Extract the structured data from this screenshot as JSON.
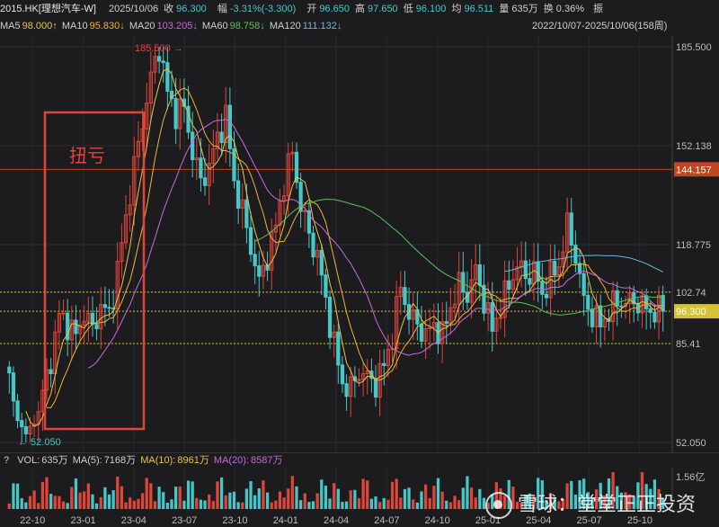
{
  "header": {
    "symbol": "2015.HK[理想汽车-W]",
    "date": "2025/10/06",
    "close_label": "收",
    "close": "96.300",
    "change_label": "幅",
    "change": "-3.31%(-3.300)",
    "open_label": "开",
    "open": "96.650",
    "high_label": "高",
    "high": "97.650",
    "low_label": "低",
    "low": "96.100",
    "avg_label": "均",
    "avg": "96.511",
    "vol_label": "量",
    "vol": "635万",
    "turnover_label": "换",
    "turnover": "0.36%",
    "amp_label": "振"
  },
  "ma_row": {
    "range_text": "2022/10/07-2025/10/06(158周)",
    "items": [
      {
        "label": "MA5",
        "value": "98.000↑",
        "color": "#e8c547"
      },
      {
        "label": "MA10",
        "value": "95.830↓",
        "color": "#f2b233"
      },
      {
        "label": "MA20",
        "value": "103.205↓",
        "color": "#c86adc"
      },
      {
        "label": "MA60",
        "value": "98.758↓",
        "color": "#5fbf5f"
      },
      {
        "label": "MA120",
        "value": "111.132↓",
        "color": "#6fb6d8"
      }
    ]
  },
  "annotation": {
    "text": "扭亏",
    "color": "#e0453a"
  },
  "volume_row": {
    "prefix": "?",
    "items": [
      {
        "label": "VOL:",
        "value": "635万",
        "color": "#cfcfcf"
      },
      {
        "label": "MA(5):",
        "value": "7168万",
        "color": "#cfcfcf"
      },
      {
        "label": "MA(10):",
        "value": "8961万",
        "color": "#e8c547"
      },
      {
        "label": "MA(20):",
        "value": "8587万",
        "color": "#c86adc"
      }
    ]
  },
  "watermark": "雪球：堂堂正正投资",
  "chart_data": {
    "type": "candlestick",
    "period": "weekly",
    "x_ticks": [
      "22-10",
      "23-01",
      "23-04",
      "23-07",
      "23-10",
      "24-01",
      "24-04",
      "24-07",
      "24-10",
      "25-01",
      "25-04",
      "25-07",
      "25-10"
    ],
    "y_ticks": [
      "185.500",
      "152.138",
      "118.775",
      "102.74",
      "85.41",
      "52.050"
    ],
    "y_tick_values": [
      185.5,
      152.138,
      118.775,
      102.74,
      85.41,
      52.05
    ],
    "ylim": [
      52.05,
      185.5
    ],
    "max_label": "185.500",
    "min_label": "52.050",
    "ref_lines": [
      {
        "value": 144.157,
        "label": "144.157",
        "color": "#c0461f"
      },
      {
        "value": 102.74,
        "color": "#d6c236"
      },
      {
        "value": 96.3,
        "label": "96.300",
        "color": "#d6c236"
      },
      {
        "value": 85.41,
        "color": "#d6c236"
      }
    ],
    "volume_ticks": [
      "1.56亿"
    ],
    "volume_max": 156000000,
    "colors": {
      "up": "#e0453a",
      "down": "#45c8c8"
    },
    "anchors": [
      [
        0,
        73
      ],
      [
        2,
        58
      ],
      [
        3,
        62
      ],
      [
        4,
        52.05
      ],
      [
        6,
        60
      ],
      [
        8,
        68
      ],
      [
        10,
        80
      ],
      [
        12,
        95
      ],
      [
        14,
        92
      ],
      [
        16,
        88
      ],
      [
        18,
        96
      ],
      [
        20,
        90
      ],
      [
        22,
        98
      ],
      [
        24,
        95
      ],
      [
        26,
        110
      ],
      [
        28,
        128
      ],
      [
        30,
        145
      ],
      [
        32,
        160
      ],
      [
        34,
        175
      ],
      [
        36,
        185.5
      ],
      [
        38,
        170
      ],
      [
        40,
        163
      ],
      [
        42,
        165
      ],
      [
        44,
        150
      ],
      [
        46,
        140
      ],
      [
        48,
        145
      ],
      [
        50,
        155
      ],
      [
        52,
        162
      ],
      [
        54,
        140
      ],
      [
        56,
        130
      ],
      [
        58,
        118
      ],
      [
        60,
        106
      ],
      [
        62,
        115
      ],
      [
        64,
        125
      ],
      [
        66,
        140
      ],
      [
        68,
        150
      ],
      [
        70,
        132
      ],
      [
        72,
        122
      ],
      [
        74,
        115
      ],
      [
        76,
        100
      ],
      [
        78,
        85
      ],
      [
        80,
        72
      ],
      [
        82,
        70
      ],
      [
        84,
        76
      ],
      [
        86,
        74
      ],
      [
        88,
        72
      ],
      [
        90,
        78
      ],
      [
        92,
        88
      ],
      [
        94,
        105
      ],
      [
        96,
        95
      ],
      [
        98,
        92
      ],
      [
        100,
        88
      ],
      [
        102,
        92
      ],
      [
        104,
        88
      ],
      [
        106,
        98
      ],
      [
        108,
        105
      ],
      [
        110,
        102
      ],
      [
        112,
        110
      ],
      [
        114,
        100
      ],
      [
        116,
        90
      ],
      [
        118,
        98
      ],
      [
        120,
        105
      ],
      [
        122,
        112
      ],
      [
        124,
        108
      ],
      [
        126,
        110
      ],
      [
        128,
        102
      ],
      [
        130,
        108
      ],
      [
        132,
        112
      ],
      [
        134,
        125
      ],
      [
        136,
        115
      ],
      [
        138,
        100
      ],
      [
        140,
        95
      ],
      [
        142,
        92
      ],
      [
        144,
        96
      ],
      [
        146,
        100
      ],
      [
        148,
        99
      ],
      [
        150,
        100
      ],
      [
        152,
        98
      ],
      [
        154,
        96.3
      ],
      [
        157,
        96.3
      ]
    ]
  }
}
